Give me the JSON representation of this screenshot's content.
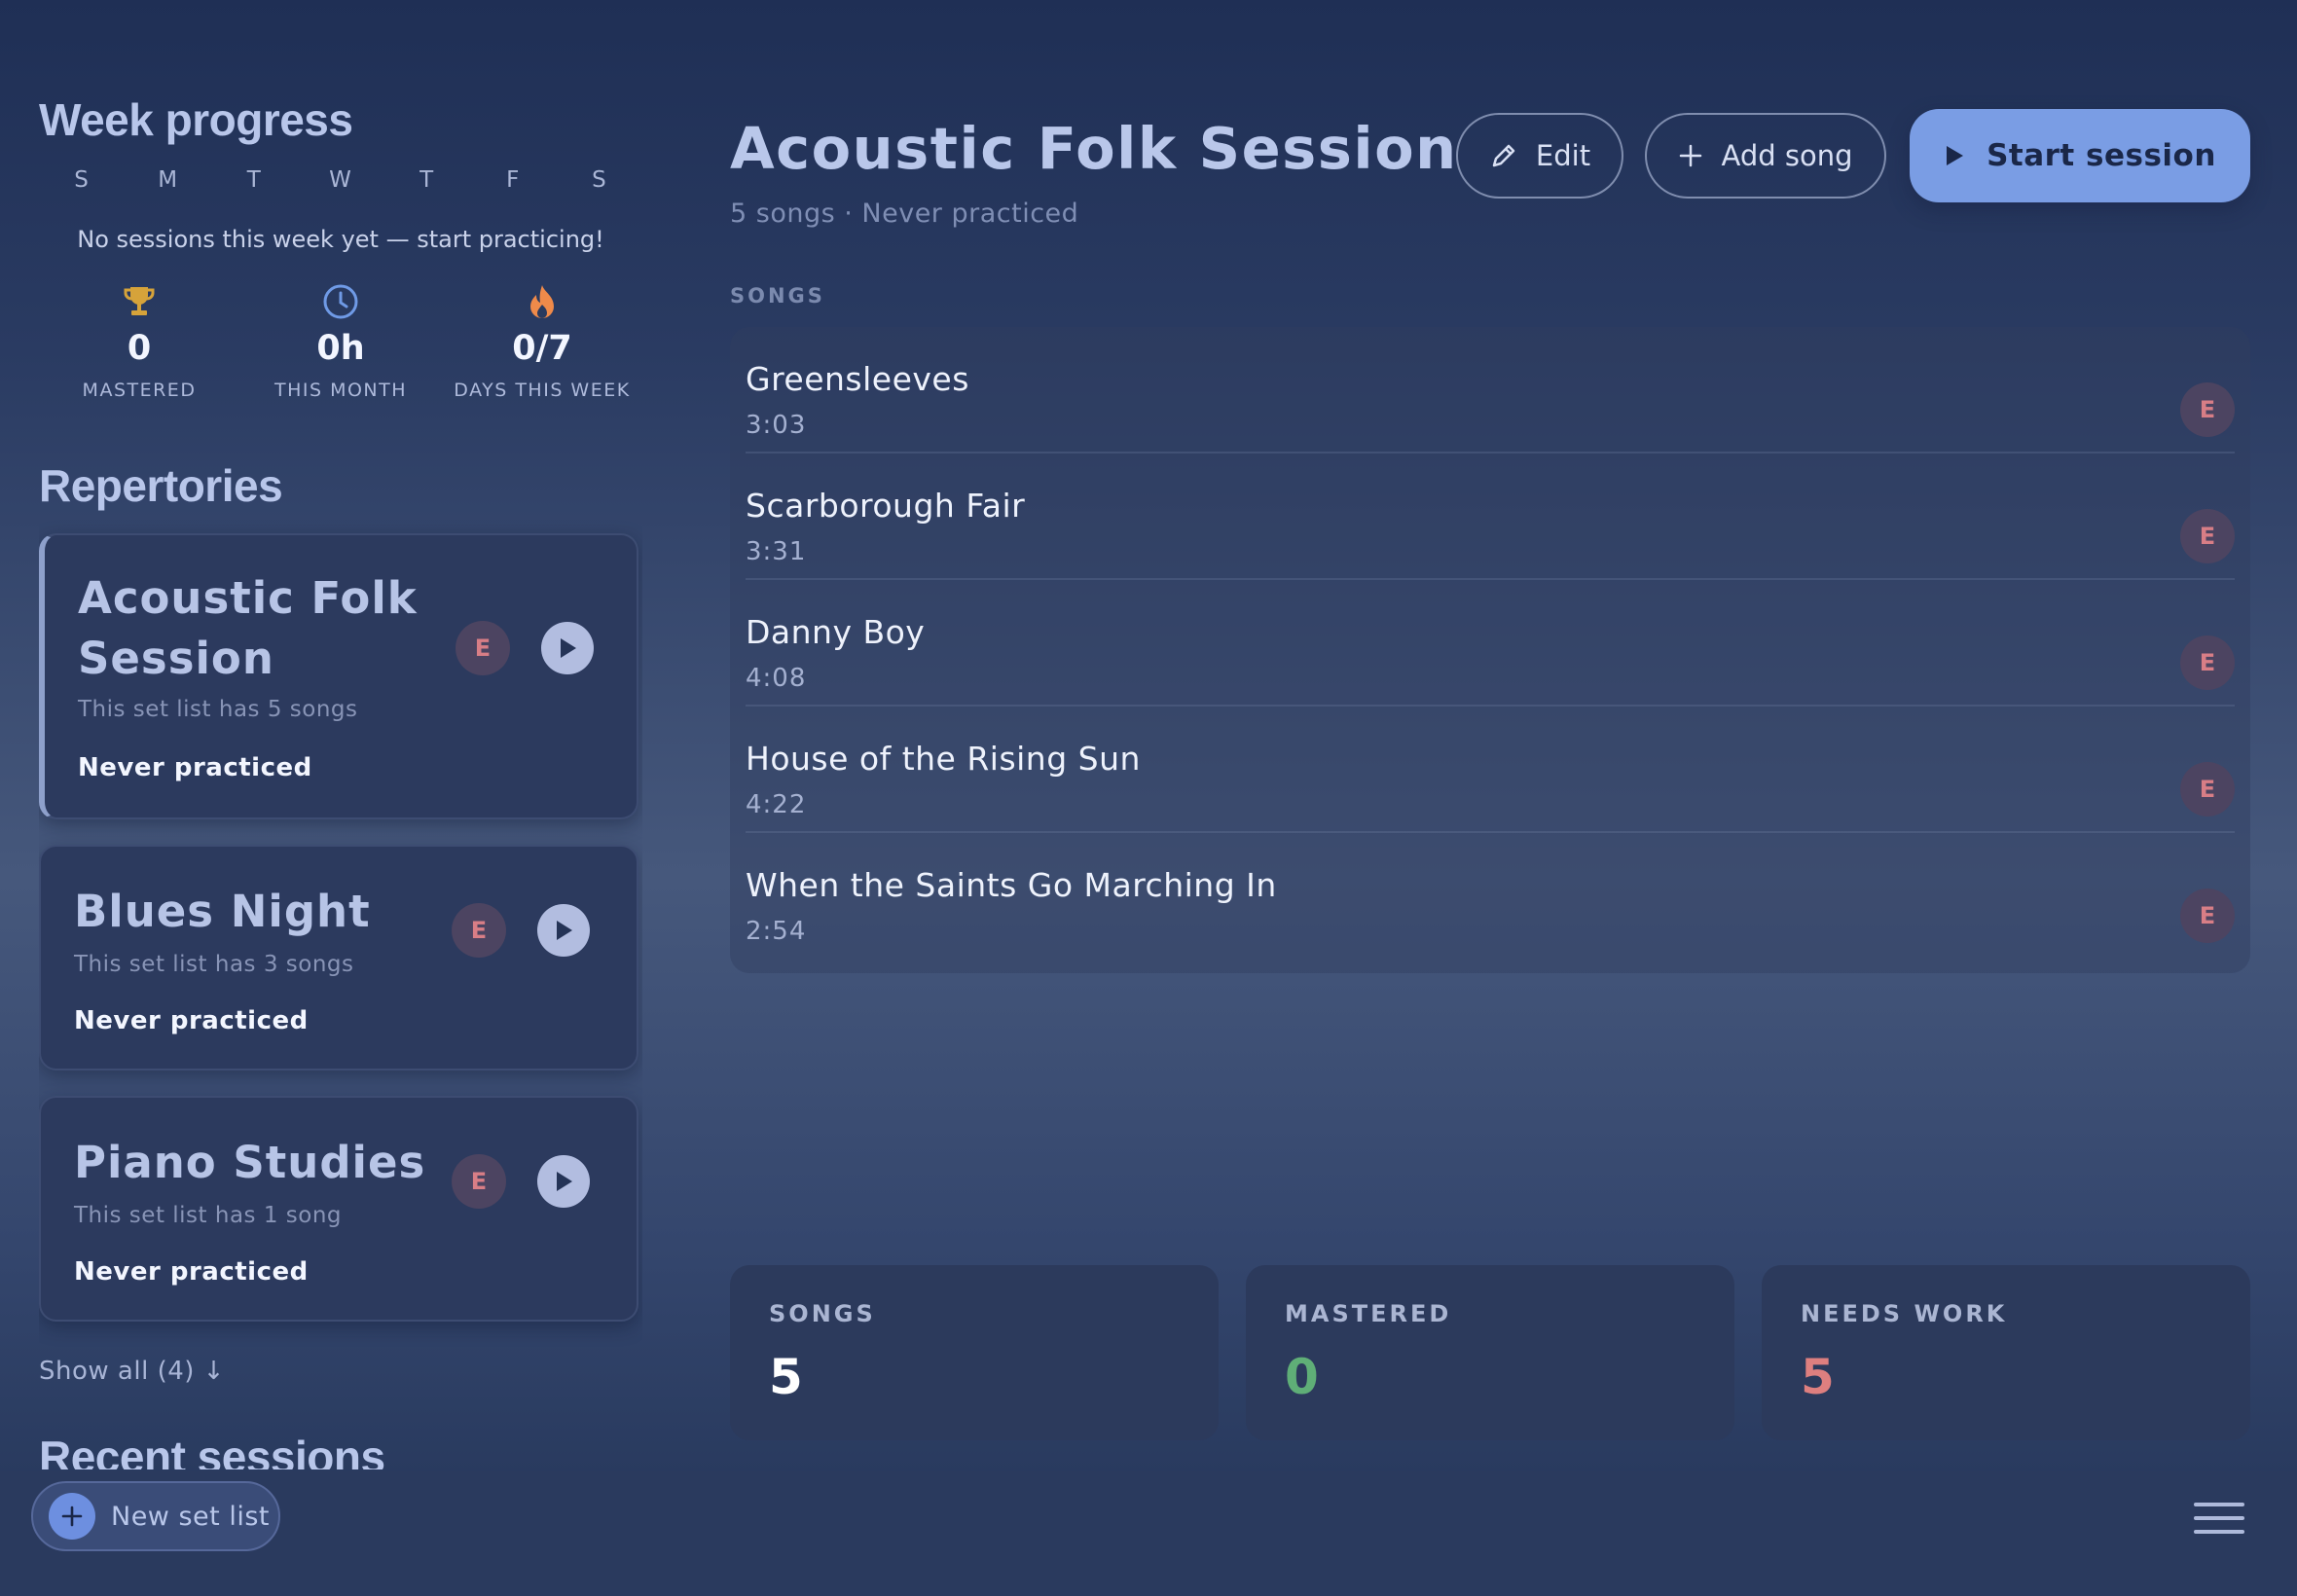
{
  "week": {
    "title": "Week progress",
    "days": [
      "S",
      "M",
      "T",
      "W",
      "T",
      "F",
      "S"
    ],
    "message": "No sessions this week yet — start practicing!",
    "stats": [
      {
        "icon": "trophy-icon",
        "value": "0",
        "label": "MASTERED",
        "color": "#d6a33a"
      },
      {
        "icon": "clock-icon",
        "value": "0h",
        "label": "THIS MONTH",
        "color": "#6f9ae6"
      },
      {
        "icon": "flame-icon",
        "value": "0/7",
        "label": "DAYS THIS WEEK",
        "color": "#ef8a4a"
      }
    ]
  },
  "repertories": {
    "title": "Repertories",
    "items": [
      {
        "name": "Acoustic Folk Session",
        "subtitle": "This set list has 5 songs",
        "status": "Never practiced",
        "badge": "E",
        "active": true
      },
      {
        "name": "Blues Night",
        "subtitle": "This set list has 3 songs",
        "status": "Never practiced",
        "badge": "E",
        "active": false
      },
      {
        "name": "Piano Studies",
        "subtitle": "This set list has 1 song",
        "status": "Never practiced",
        "badge": "E",
        "active": false
      }
    ],
    "show_all": "Show all (4) ↓"
  },
  "recent_sessions": {
    "title": "Recent sessions"
  },
  "main": {
    "title": "Acoustic Folk Session",
    "subtitle": "5 songs · Never practiced",
    "buttons": {
      "edit": "Edit",
      "add_song": "Add song",
      "start_session": "Start session"
    },
    "songs_label": "SONGS",
    "songs": [
      {
        "title": "Greensleeves",
        "duration": "3:03",
        "badge": "E"
      },
      {
        "title": "Scarborough Fair",
        "duration": "3:31",
        "badge": "E"
      },
      {
        "title": "Danny Boy",
        "duration": "4:08",
        "badge": "E"
      },
      {
        "title": "House of the Rising Sun",
        "duration": "4:22",
        "badge": "E"
      },
      {
        "title": "When the Saints Go Marching In",
        "duration": "2:54",
        "badge": "E"
      }
    ],
    "summary": [
      {
        "label": "SONGS",
        "value": "5",
        "color": "#ffffff"
      },
      {
        "label": "MASTERED",
        "value": "0",
        "color": "#5fae77"
      },
      {
        "label": "NEEDS WORK",
        "value": "5",
        "color": "#de7f7f"
      }
    ]
  },
  "footer": {
    "new_set_list": "New set list"
  },
  "colors": {
    "accent": "#7a9de4",
    "badge_text": "#d87e86",
    "badge_bg": "#4c4461"
  }
}
